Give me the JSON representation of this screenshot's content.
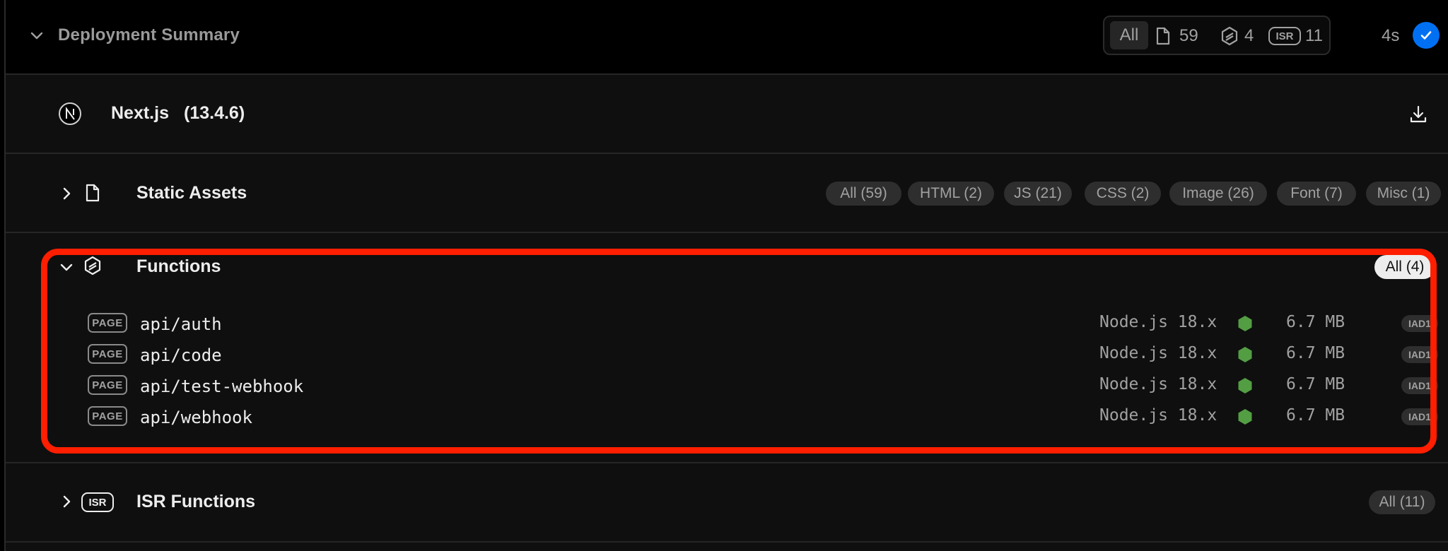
{
  "header": {
    "title": "Deployment Summary",
    "counters": {
      "all_label": "All",
      "static_count": "59",
      "functions_count": "4",
      "isr_label": "ISR",
      "isr_count": "11"
    },
    "duration": "4s"
  },
  "framework": {
    "name": "Next.js",
    "version": "(13.4.6)"
  },
  "static_assets": {
    "title": "Static Assets",
    "filters": [
      "All (59)",
      "HTML (2)",
      "JS (21)",
      "CSS (2)",
      "Image (26)",
      "Font (7)",
      "Misc (1)"
    ]
  },
  "functions": {
    "title": "Functions",
    "filter": "All (4)",
    "items": [
      {
        "tag": "PAGE",
        "route": "api/auth",
        "runtime": "Node.js 18.x",
        "size": "6.7 MB",
        "region": "IAD1"
      },
      {
        "tag": "PAGE",
        "route": "api/code",
        "runtime": "Node.js 18.x",
        "size": "6.7 MB",
        "region": "IAD1"
      },
      {
        "tag": "PAGE",
        "route": "api/test-webhook",
        "runtime": "Node.js 18.x",
        "size": "6.7 MB",
        "region": "IAD1"
      },
      {
        "tag": "PAGE",
        "route": "api/webhook",
        "runtime": "Node.js 18.x",
        "size": "6.7 MB",
        "region": "IAD1"
      }
    ]
  },
  "isr_functions": {
    "badge": "ISR",
    "title": "ISR Functions",
    "filter": "All (11)"
  },
  "colors": {
    "background": "#000000",
    "section_bg": "#0f0f0f",
    "highlight": "#ff1e00",
    "success_blue": "#0070f3",
    "node_green": "#539e43"
  },
  "icons": {
    "collapse": "chevron-down-icon",
    "expand": "chevron-right-icon",
    "file": "file-icon",
    "functions": "function-hexagon-icon",
    "download": "download-icon",
    "status": "check-icon",
    "nextjs": "nextjs-logo-icon",
    "node": "nodejs-hexagon-icon"
  }
}
